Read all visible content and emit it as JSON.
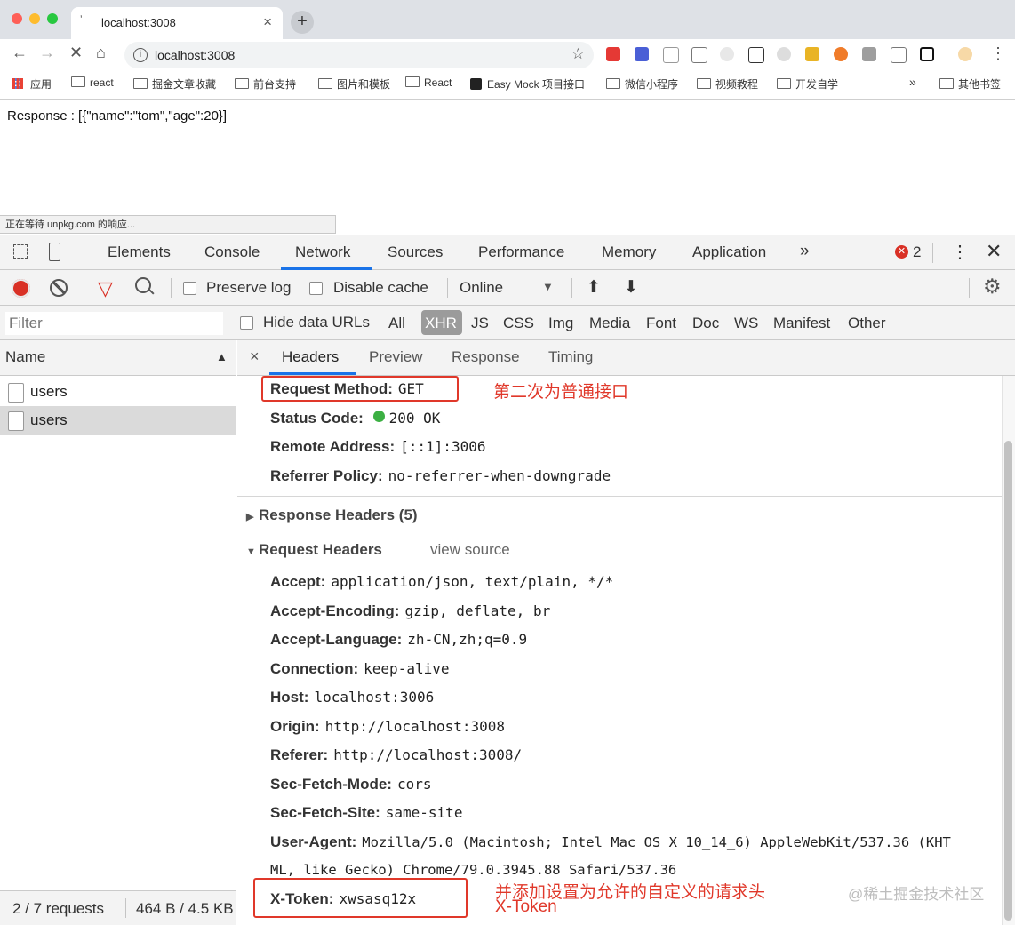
{
  "browser": {
    "tab_title": "localhost:3008",
    "url": "localhost:3008",
    "bookmarks": [
      "应用",
      "react",
      "掘金文章收藏",
      "前台支持",
      "图片和模板",
      "React",
      "Easy Mock 项目接口",
      "微信小程序",
      "视频教程",
      "开发自学"
    ],
    "bookmarks_more": "»",
    "other_bookmarks": "其他书签"
  },
  "page": {
    "response_text": "Response : [{\"name\":\"tom\",\"age\":20}]",
    "status_bubble": "正在等待 unpkg.com 的响应..."
  },
  "devtools": {
    "tabs": [
      "Elements",
      "Console",
      "Network",
      "Sources",
      "Performance",
      "Memory",
      "Application"
    ],
    "active_tab": "Network",
    "overflow": "»",
    "error_count": "2",
    "preserve_log": "Preserve log",
    "disable_cache": "Disable cache",
    "throttle": "Online",
    "filter_placeholder": "Filter",
    "hide_data_urls": "Hide data URLs",
    "types": [
      "All",
      "XHR",
      "JS",
      "CSS",
      "Img",
      "Media",
      "Font",
      "Doc",
      "WS",
      "Manifest",
      "Other"
    ],
    "active_type": "XHR",
    "name_header": "Name",
    "requests": [
      "users",
      "users"
    ],
    "footer_requests": "2 / 7 requests",
    "footer_size": "464 B / 4.5 KB",
    "detail_close": "×",
    "detail_tabs": [
      "Headers",
      "Preview",
      "Response",
      "Timing"
    ],
    "general": [
      {
        "k": "Request Method:",
        "v": "GET"
      },
      {
        "k": "Status Code:",
        "v": "200 OK"
      },
      {
        "k": "Remote Address:",
        "v": "[::1]:3006"
      },
      {
        "k": "Referrer Policy:",
        "v": "no-referrer-when-downgrade"
      }
    ],
    "response_headers_label": "Response Headers (5)",
    "request_headers_label": "Request Headers",
    "view_source": "view source",
    "request_headers": [
      {
        "k": "Accept:",
        "v": "application/json, text/plain, */*"
      },
      {
        "k": "Accept-Encoding:",
        "v": "gzip, deflate, br"
      },
      {
        "k": "Accept-Language:",
        "v": "zh-CN,zh;q=0.9"
      },
      {
        "k": "Connection:",
        "v": "keep-alive"
      },
      {
        "k": "Host:",
        "v": "localhost:3006"
      },
      {
        "k": "Origin:",
        "v": "http://localhost:3008"
      },
      {
        "k": "Referer:",
        "v": "http://localhost:3008/"
      },
      {
        "k": "Sec-Fetch-Mode:",
        "v": "cors"
      },
      {
        "k": "Sec-Fetch-Site:",
        "v": "same-site"
      },
      {
        "k": "User-Agent:",
        "v": "Mozilla/5.0 (Macintosh; Intel Mac OS X 10_14_6) AppleWebKit/537.36 (KHT"
      },
      {
        "k": "X-Token:",
        "v": "xwsasq12x"
      }
    ],
    "ua_wrap": "ML, like Gecko) Chrome/79.0.3945.88 Safari/537.36"
  },
  "annotations": {
    "method_note": "第二次为普通接口",
    "token_note_1": "并添加设置为允许的自定义的请求头",
    "token_note_2": "X-Token",
    "watermark": "@稀土掘金技术社区"
  },
  "colors": {
    "accent": "#1a73e8",
    "annotation": "#e0382a",
    "record": "#d93025",
    "status_ok": "#3cb043"
  }
}
